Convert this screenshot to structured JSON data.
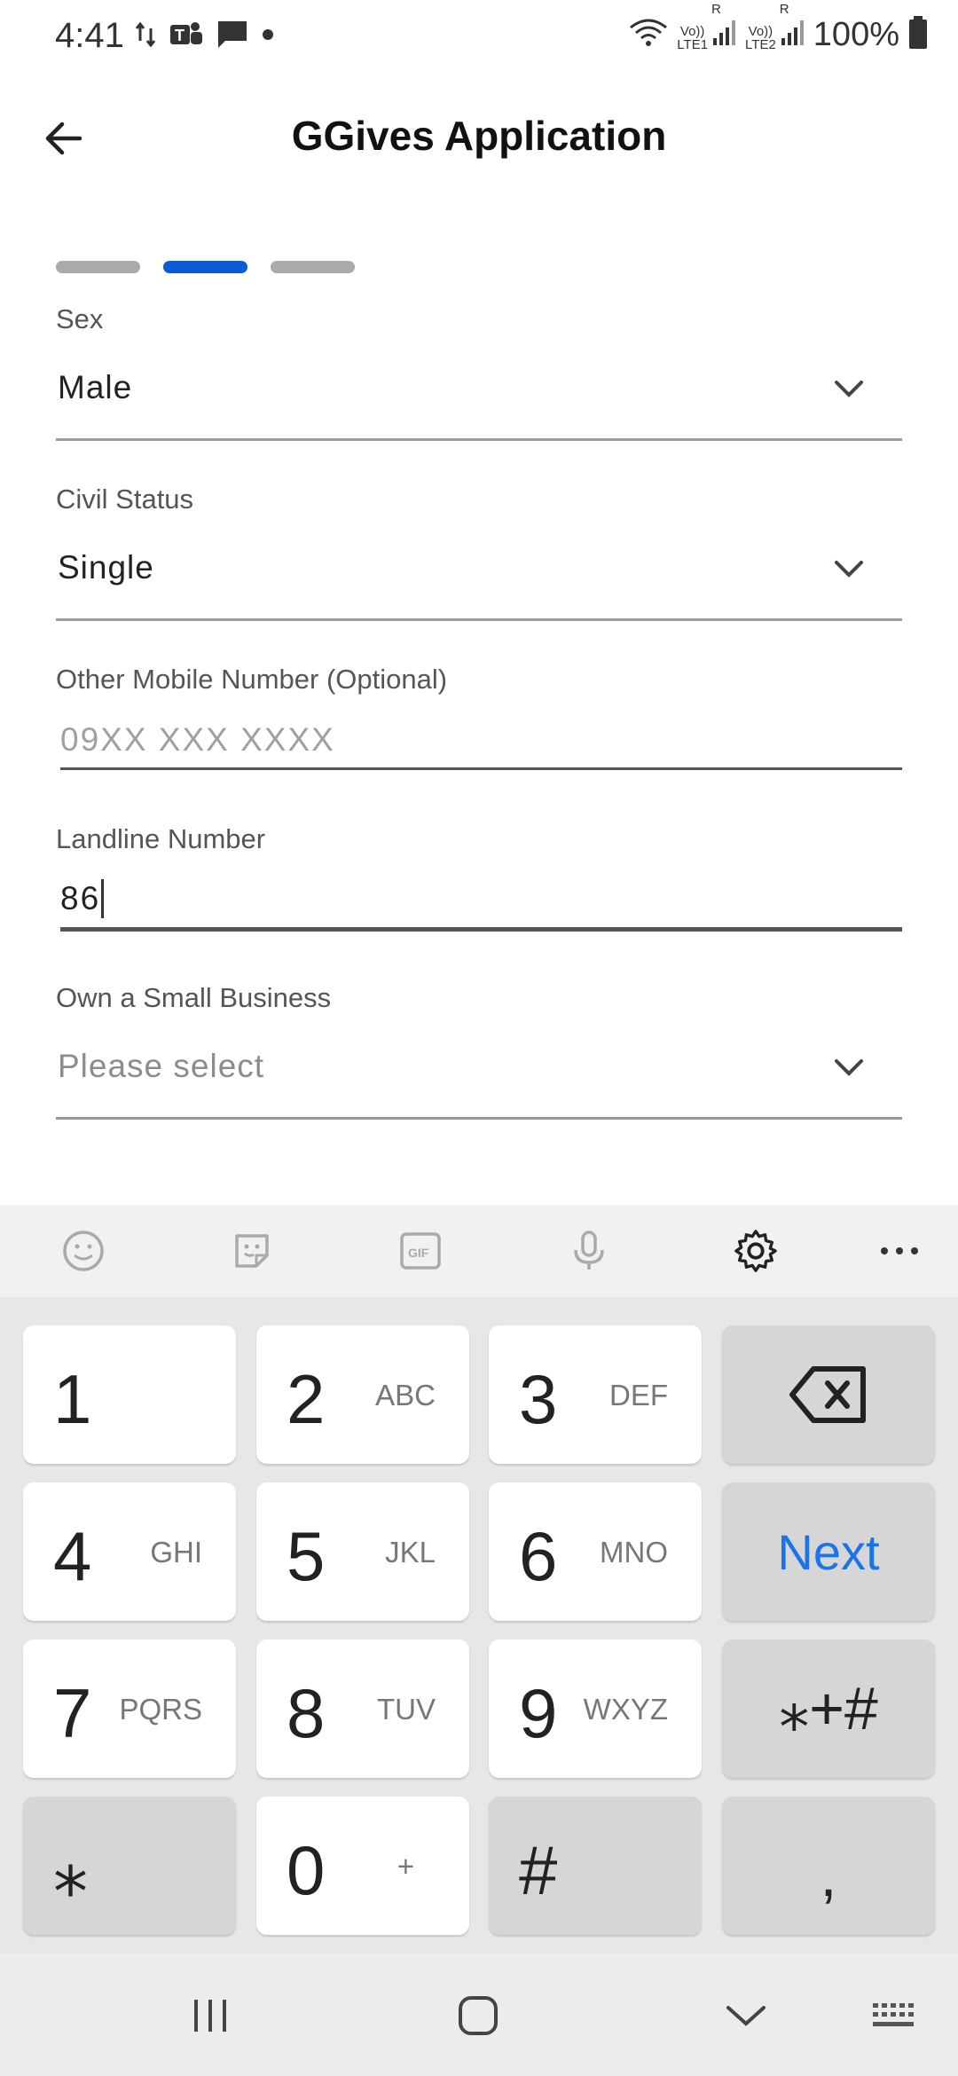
{
  "status_bar": {
    "time": "4:41",
    "battery": "100%",
    "lte1": "LTE1",
    "lte2": "LTE2",
    "volte": "Vo))",
    "roaming": "R"
  },
  "app_bar": {
    "title": "GGives Application"
  },
  "progress": {
    "total_steps": 3,
    "current_step": 2,
    "accent_color": "#0b5bd7"
  },
  "form": {
    "sex": {
      "label": "Sex",
      "value": "Male"
    },
    "civil_status": {
      "label": "Civil Status",
      "value": "Single"
    },
    "other_mobile": {
      "label": "Other Mobile Number (Optional)",
      "value": "",
      "placeholder": "09XX XXX XXXX"
    },
    "landline": {
      "label": "Landline Number",
      "value": "86"
    },
    "small_business": {
      "label": "Own a Small Business",
      "placeholder": "Please select"
    }
  },
  "keyboard": {
    "toolbar": [
      "emoji-icon",
      "sticker-icon",
      "gif-icon",
      "mic-icon",
      "settings-icon",
      "more-icon"
    ],
    "gif_label": "GIF",
    "keys": {
      "k1": {
        "num": "1",
        "letters": ""
      },
      "k2": {
        "num": "2",
        "letters": "ABC"
      },
      "k3": {
        "num": "3",
        "letters": "DEF"
      },
      "k4": {
        "num": "4",
        "letters": "GHI"
      },
      "k5": {
        "num": "5",
        "letters": "JKL"
      },
      "k6": {
        "num": "6",
        "letters": "MNO"
      },
      "k7": {
        "num": "7",
        "letters": "PQRS"
      },
      "k8": {
        "num": "8",
        "letters": "TUV"
      },
      "k9": {
        "num": "9",
        "letters": "WXYZ"
      },
      "k0": {
        "num": "0",
        "letters": "+"
      },
      "star": "⁎",
      "hash": "#",
      "symbols": "⁎+#",
      "comma": ",",
      "next": "Next"
    },
    "next_color": "#1a73e8"
  }
}
